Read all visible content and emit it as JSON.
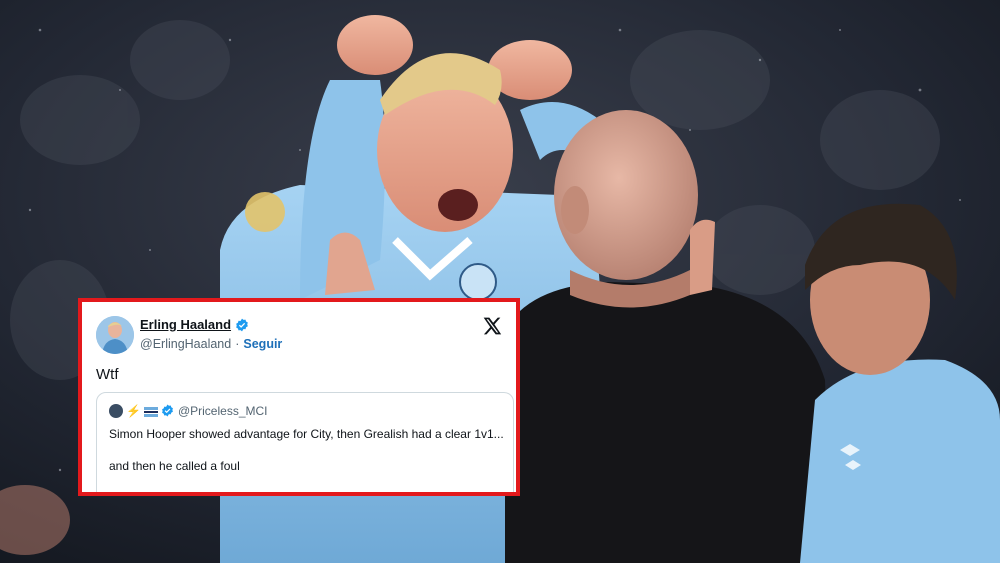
{
  "tweet": {
    "display_name": "Erling Haaland",
    "handle": "@ErlingHaaland",
    "separator": "·",
    "follow_label": "Seguir",
    "text": "Wtf",
    "icons": {
      "platform": "x-logo-icon",
      "verified": "verified-badge-icon"
    },
    "quoted": {
      "handle": "@Priceless_MCI",
      "emoji": "⚡",
      "line1": "Simon Hooper showed advantage for City, then Grealish had a clear 1v1...",
      "line2": "and then he called a foul"
    }
  },
  "colors": {
    "frame": "#e3191c",
    "link": "#1d6fb8",
    "verified": "#1d9bf0",
    "kit_sky_blue": "#8ec3ea",
    "referee_black": "#151518"
  }
}
